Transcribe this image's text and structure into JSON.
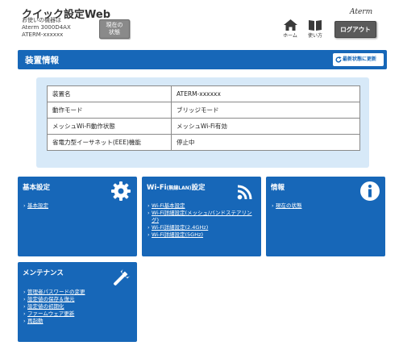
{
  "header": {
    "app_title": "クイック設定Web",
    "device_info": {
      "line1": "お使いの機器は",
      "line2": "Aterm 3000D4AX",
      "line3": "ATERM-xxxxxx"
    },
    "status_button": {
      "line1": "現在の",
      "line2": "状態"
    },
    "nav": {
      "home_label": "ホーム",
      "help_label": "使い方"
    },
    "logout_label": "ログアウト",
    "brand": "Aterm"
  },
  "section": {
    "title": "装置情報",
    "refresh_label": "最新状態に更新"
  },
  "device_table": {
    "rows": [
      {
        "label": "装置名",
        "value": "ATERM-xxxxxx"
      },
      {
        "label": "動作モード",
        "value": "ブリッジモード"
      },
      {
        "label": "メッシュWi-Fi動作状態",
        "value": "メッシュWi-Fi有効"
      },
      {
        "label": "省電力型イーサネット(EEE)機能",
        "value": "停止中"
      }
    ]
  },
  "cards": {
    "basic": {
      "title": "基本設定",
      "icon": "gear-icon",
      "links": [
        "基本設定"
      ]
    },
    "wifi": {
      "title": "Wi-Fi",
      "title_small": "(無線LAN)",
      "title_suffix": "設定",
      "icon": "wifi-icon",
      "links": [
        "Wi-Fi基本設定",
        "Wi-Fi詳細設定(メッシュ/バンドステアリング)",
        "Wi-Fi詳細設定(2.4GHz)",
        "Wi-Fi詳細設定(5GHz)"
      ]
    },
    "info": {
      "title": "情報",
      "icon": "info-icon",
      "links": [
        "現在の状態"
      ]
    },
    "maintenance": {
      "title": "メンテナンス",
      "icon": "wrench-icon",
      "links": [
        "管理者パスワードの変更",
        "設定値の保存＆復元",
        "設定値の初期化",
        "ファームウェア更新",
        "再起動"
      ]
    }
  },
  "colors": {
    "primary": "#1767b8",
    "panel": "#d7e9f8",
    "button_gray": "#5a5a5a"
  }
}
